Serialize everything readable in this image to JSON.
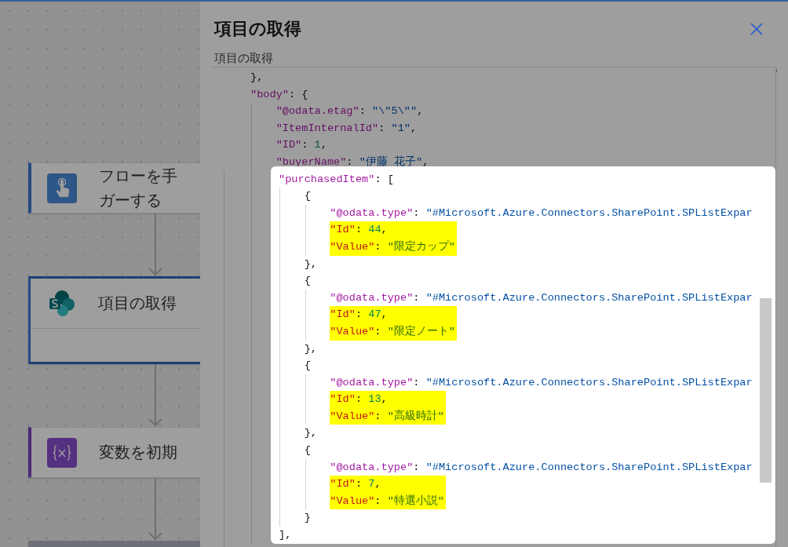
{
  "flow_steps": [
    {
      "kind": "trigger",
      "title": [
        "フローを手",
        "ガーする"
      ],
      "selected": false
    },
    {
      "kind": "sharepoint",
      "title": [
        "項目の取得"
      ],
      "selected": true
    },
    {
      "kind": "variable",
      "title": [
        "変数を初期"
      ],
      "selected": false
    },
    {
      "kind": "partial",
      "selected": false
    }
  ],
  "panel": {
    "title": "項目の取得",
    "subtitle": "項目の取得",
    "top_lines": [
      {
        "tokens": [
          {
            "kind": "punct",
            "text": "},"
          }
        ]
      },
      {
        "tokens": [
          {
            "kind": "key",
            "text": "\"body\""
          },
          {
            "kind": "punct",
            "text": ": {"
          }
        ],
        "children": [
          {
            "tokens": [
              {
                "kind": "key",
                "text": "\"@odata.etag\""
              },
              {
                "kind": "punct",
                "text": ": "
              },
              {
                "kind": "string",
                "text": "\"\\\"5\\\"\""
              },
              {
                "kind": "punct",
                "text": ","
              }
            ]
          },
          {
            "tokens": [
              {
                "kind": "key",
                "text": "\"ItemInternalId\""
              },
              {
                "kind": "punct",
                "text": ": "
              },
              {
                "kind": "string",
                "text": "\"1\""
              },
              {
                "kind": "punct",
                "text": ","
              }
            ]
          },
          {
            "tokens": [
              {
                "kind": "key",
                "text": "\"ID\""
              },
              {
                "kind": "punct",
                "text": ": "
              },
              {
                "kind": "number",
                "text": "1"
              },
              {
                "kind": "punct",
                "text": ","
              }
            ]
          },
          {
            "tokens": [
              {
                "kind": "key",
                "text": "\"buyerName\""
              },
              {
                "kind": "punct",
                "text": ": "
              },
              {
                "kind": "string",
                "text": "\"伊藤 花子\""
              },
              {
                "kind": "punct",
                "text": ","
              }
            ]
          }
        ]
      }
    ],
    "spotlight_lines": [
      {
        "tokens": [
          {
            "kind": "key",
            "text": "\"purchasedItem\""
          },
          {
            "kind": "punct",
            "text": ": ["
          }
        ],
        "children": [
          {
            "tokens": [
              {
                "kind": "punct",
                "text": "{"
              }
            ],
            "children": [
              {
                "tokens": [
                  {
                    "kind": "key",
                    "text": "\"@odata.type\""
                  },
                  {
                    "kind": "punct",
                    "text": ": "
                  },
                  {
                    "kind": "string",
                    "text": "\"#Microsoft.Azure.Connectors.SharePoint.SPListExpar"
                  }
                ]
              },
              {
                "kind": "highlight",
                "lines": [
                  {
                    "tokens": [
                      {
                        "kind": "key",
                        "text": "\"Id\""
                      },
                      {
                        "kind": "punct",
                        "text": ": "
                      },
                      {
                        "kind": "number",
                        "text": "44"
                      },
                      {
                        "kind": "punct",
                        "text": ","
                      }
                    ]
                  },
                  {
                    "tokens": [
                      {
                        "kind": "key",
                        "text": "\"Value\""
                      },
                      {
                        "kind": "punct",
                        "text": ": "
                      },
                      {
                        "kind": "string",
                        "text": "\"限定カップ\""
                      }
                    ]
                  }
                ]
              }
            ]
          },
          {
            "tokens": [
              {
                "kind": "punct",
                "text": "},"
              }
            ]
          },
          {
            "tokens": [
              {
                "kind": "punct",
                "text": "{"
              }
            ],
            "children": [
              {
                "tokens": [
                  {
                    "kind": "key",
                    "text": "\"@odata.type\""
                  },
                  {
                    "kind": "punct",
                    "text": ": "
                  },
                  {
                    "kind": "string",
                    "text": "\"#Microsoft.Azure.Connectors.SharePoint.SPListExpar"
                  }
                ]
              },
              {
                "kind": "highlight",
                "lines": [
                  {
                    "tokens": [
                      {
                        "kind": "key",
                        "text": "\"Id\""
                      },
                      {
                        "kind": "punct",
                        "text": ": "
                      },
                      {
                        "kind": "number",
                        "text": "47"
                      },
                      {
                        "kind": "punct",
                        "text": ","
                      }
                    ]
                  },
                  {
                    "tokens": [
                      {
                        "kind": "key",
                        "text": "\"Value\""
                      },
                      {
                        "kind": "punct",
                        "text": ": "
                      },
                      {
                        "kind": "string",
                        "text": "\"限定ノート\""
                      }
                    ]
                  }
                ]
              }
            ]
          },
          {
            "tokens": [
              {
                "kind": "punct",
                "text": "},"
              }
            ]
          },
          {
            "tokens": [
              {
                "kind": "punct",
                "text": "{"
              }
            ],
            "children": [
              {
                "tokens": [
                  {
                    "kind": "key",
                    "text": "\"@odata.type\""
                  },
                  {
                    "kind": "punct",
                    "text": ": "
                  },
                  {
                    "kind": "string",
                    "text": "\"#Microsoft.Azure.Connectors.SharePoint.SPListExpar"
                  }
                ]
              },
              {
                "kind": "highlight",
                "lines": [
                  {
                    "tokens": [
                      {
                        "kind": "key",
                        "text": "\"Id\""
                      },
                      {
                        "kind": "punct",
                        "text": ": "
                      },
                      {
                        "kind": "number",
                        "text": "13"
                      },
                      {
                        "kind": "punct",
                        "text": ","
                      }
                    ]
                  },
                  {
                    "tokens": [
                      {
                        "kind": "key",
                        "text": "\"Value\""
                      },
                      {
                        "kind": "punct",
                        "text": ": "
                      },
                      {
                        "kind": "string",
                        "text": "\"高級時計\""
                      }
                    ]
                  }
                ]
              }
            ]
          },
          {
            "tokens": [
              {
                "kind": "punct",
                "text": "},"
              }
            ]
          },
          {
            "tokens": [
              {
                "kind": "punct",
                "text": "{"
              }
            ],
            "children": [
              {
                "tokens": [
                  {
                    "kind": "key",
                    "text": "\"@odata.type\""
                  },
                  {
                    "kind": "punct",
                    "text": ": "
                  },
                  {
                    "kind": "string",
                    "text": "\"#Microsoft.Azure.Connectors.SharePoint.SPListExpar"
                  }
                ]
              },
              {
                "kind": "highlight",
                "lines": [
                  {
                    "tokens": [
                      {
                        "kind": "key",
                        "text": "\"Id\""
                      },
                      {
                        "kind": "punct",
                        "text": ": "
                      },
                      {
                        "kind": "number",
                        "text": "7"
                      },
                      {
                        "kind": "punct",
                        "text": ","
                      }
                    ]
                  },
                  {
                    "tokens": [
                      {
                        "kind": "key",
                        "text": "\"Value\""
                      },
                      {
                        "kind": "punct",
                        "text": ": "
                      },
                      {
                        "kind": "string",
                        "text": "\"特選小説\""
                      }
                    ]
                  }
                ]
              }
            ]
          },
          {
            "tokens": [
              {
                "kind": "punct",
                "text": "}"
              }
            ]
          }
        ]
      },
      {
        "tokens": [
          {
            "kind": "punct",
            "text": "],"
          }
        ]
      }
    ]
  }
}
